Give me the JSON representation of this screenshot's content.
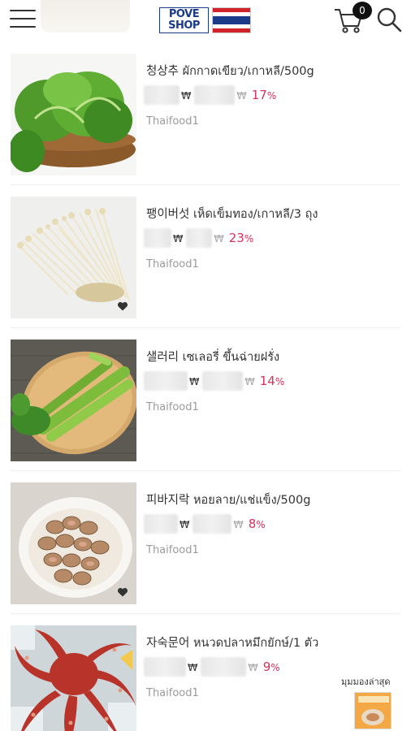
{
  "header": {
    "menu_icon": "hamburger-menu-icon",
    "logo_line1": "POVE",
    "logo_line2": "SHOP",
    "flag": "thailand-flag",
    "cart_count": "0",
    "cart_icon": "cart-icon",
    "search_icon": "search-icon"
  },
  "products": [
    {
      "title": "청상추 ผักกาดเขียว/เกาหลี/500g",
      "currency_sale": "₩",
      "currency_orig": "₩",
      "discount": "17",
      "discount_unit": "%",
      "shop": "Thaifood1",
      "image": "green-lettuce-basket",
      "wish": false
    },
    {
      "title": "팽이버섯 เห็ดเข็มทอง/เกาหลี/3 ถุง",
      "currency_sale": "₩",
      "currency_orig": "₩",
      "discount": "23",
      "discount_unit": "%",
      "shop": "Thaifood1",
      "image": "enoki-mushrooms",
      "wish": true
    },
    {
      "title": "샐러리 เซเลอรี่ ขึ้นฉ่ายฝรั่ง",
      "currency_sale": "₩",
      "currency_orig": "₩",
      "discount": "14",
      "discount_unit": "%",
      "shop": "Thaifood1",
      "image": "celery-on-plate",
      "wish": false
    },
    {
      "title": "피바지락 หอยลาย/แช่แข็ง/500g",
      "currency_sale": "₩",
      "currency_orig": "₩",
      "discount": "8",
      "discount_unit": "%",
      "shop": "Thaifood1",
      "image": "clams-in-bowl",
      "wish": true
    },
    {
      "title": "자숙문어 หนวดปลาหมึกยักษ์/1 ตัว",
      "currency_sale": "₩",
      "currency_orig": "₩",
      "discount": "9",
      "discount_unit": "%",
      "shop": "Thaifood1",
      "image": "boiled-octopus",
      "wish": false
    }
  ],
  "recently_viewed": {
    "label": "มุมมองล่าสุด",
    "thumb": "recent-product-thumbnail"
  },
  "colors": {
    "discount": "#d8315b",
    "shop": "#9a9a9a",
    "logo_blue": "#1b3b8a",
    "logo_red": "#d2232a"
  }
}
